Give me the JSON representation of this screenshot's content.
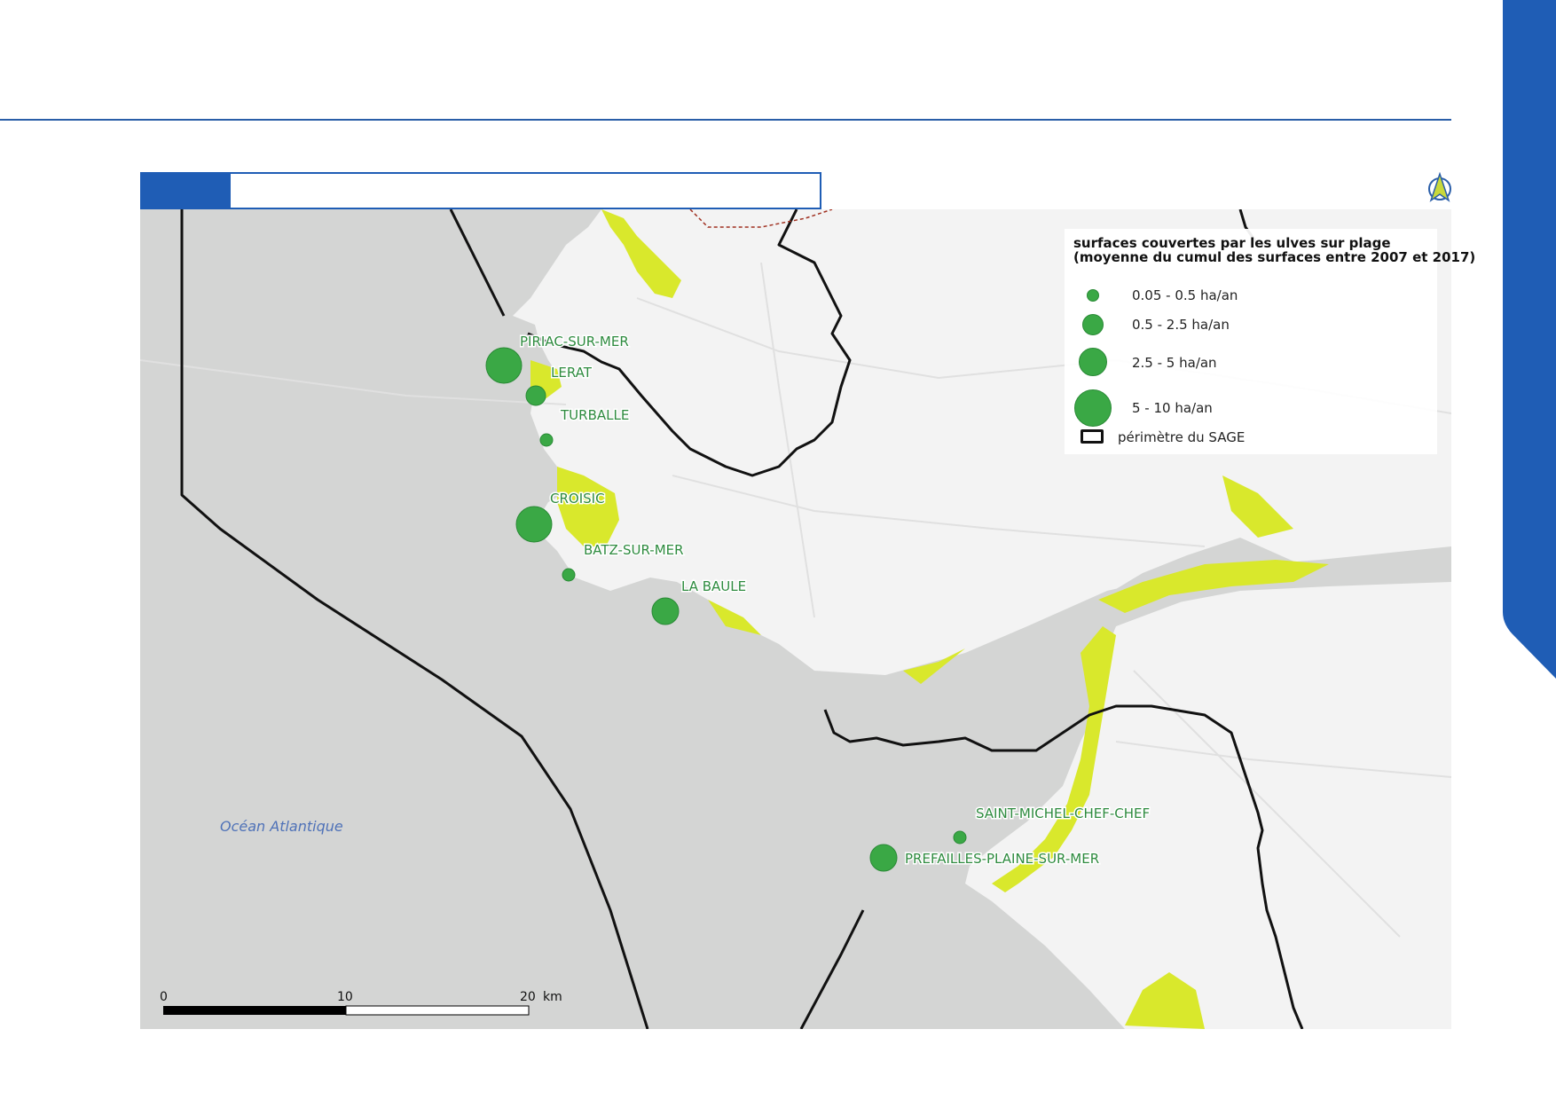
{
  "colors": {
    "accent": "#1f5db5",
    "sea": "#d4d5d4",
    "land": "#f3f3f3",
    "algae": "#d9e82c",
    "circle": "#3aa845",
    "label": "#2e8b3f",
    "sage_boundary": "#111111"
  },
  "icons": {
    "north_arrow": "north-arrow-icon"
  },
  "header": {
    "title": ""
  },
  "legend": {
    "title_line1": "surfaces couvertes par les ulves sur plage",
    "title_line2": "(moyenne du cumul des surfaces entre 2007 et 2017)",
    "classes": [
      {
        "label": "0.05 - 0.5 ha/an",
        "min": 0.05,
        "max": 0.5
      },
      {
        "label": "0.5 - 2.5 ha/an",
        "min": 0.5,
        "max": 2.5
      },
      {
        "label": "2.5 - 5 ha/an",
        "min": 2.5,
        "max": 5
      },
      {
        "label": "5 - 10 ha/an",
        "min": 5,
        "max": 10
      }
    ],
    "boundary_label": "périmètre du SAGE"
  },
  "places": [
    {
      "name": "PIRIAC-SUR-MER",
      "class_index": 3
    },
    {
      "name": "LERAT",
      "class_index": 1
    },
    {
      "name": "TURBALLE",
      "class_index": 0
    },
    {
      "name": "CROISIC",
      "class_index": 3
    },
    {
      "name": "BATZ-SUR-MER",
      "class_index": 0
    },
    {
      "name": "LA BAULE",
      "class_index": 2
    },
    {
      "name": "SAINT-MICHEL-CHEF-CHEF",
      "class_index": 0
    },
    {
      "name": "PREFAILLES-PLAINE-SUR-MER",
      "class_index": 2
    }
  ],
  "ocean_label": "Océan Atlantique",
  "scale": {
    "ticks": [
      "0",
      "10",
      "20"
    ],
    "unit": "km"
  }
}
